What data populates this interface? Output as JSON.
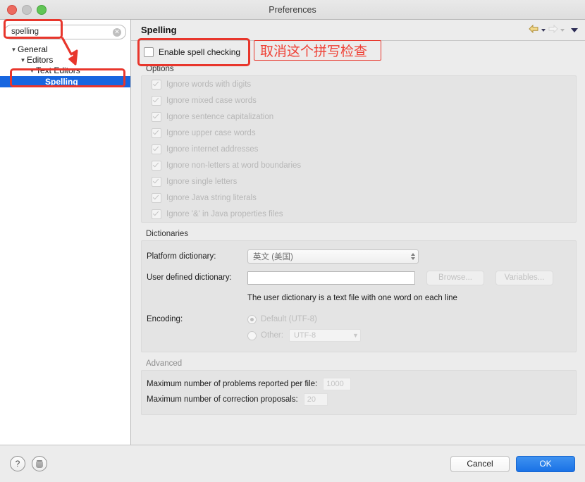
{
  "window": {
    "title": "Preferences",
    "controls": [
      "close-button",
      "minimize-button",
      "zoom-button"
    ]
  },
  "sidebar": {
    "search": {
      "value": "spelling",
      "placeholder": "type filter text",
      "clear_icon": "clear-circle-icon"
    },
    "tree": [
      {
        "label": "General",
        "indent": 0,
        "twisty": "▼",
        "selected": false
      },
      {
        "label": "Editors",
        "indent": 1,
        "twisty": "▼",
        "selected": false
      },
      {
        "label": "Text Editors",
        "indent": 2,
        "twisty": "▼",
        "selected": false
      },
      {
        "label": "Spelling",
        "indent": 3,
        "twisty": "",
        "selected": true
      }
    ]
  },
  "main": {
    "title": "Spelling",
    "nav": {
      "back_icon": "back-arrow-icon",
      "forward_icon": "forward-arrow-icon",
      "menu_icon": "chevron-down-icon"
    },
    "enable": {
      "label": "Enable spell checking",
      "checked": false
    },
    "options": {
      "title": "Options",
      "items": [
        {
          "label": "Ignore words with digits",
          "checked": true
        },
        {
          "label": "Ignore mixed case words",
          "checked": true
        },
        {
          "label": "Ignore sentence capitalization",
          "checked": true
        },
        {
          "label": "Ignore upper case words",
          "checked": true
        },
        {
          "label": "Ignore internet addresses",
          "checked": true
        },
        {
          "label": "Ignore non-letters at word boundaries",
          "checked": true
        },
        {
          "label": "Ignore single letters",
          "checked": true
        },
        {
          "label": "Ignore Java string literals",
          "checked": true
        },
        {
          "label": "Ignore '&' in Java properties files",
          "checked": true
        }
      ]
    },
    "dictionaries": {
      "title": "Dictionaries",
      "platform_label": "Platform dictionary:",
      "platform_value": "英文 (美国)",
      "user_label": "User defined dictionary:",
      "user_value": "",
      "browse_label": "Browse...",
      "variables_label": "Variables...",
      "hint": "The user dictionary is a text file with one word on each line",
      "encoding_label": "Encoding:",
      "encoding_default_label": "Default (UTF-8)",
      "encoding_default_selected": true,
      "encoding_other_label": "Other:",
      "encoding_other_value": "UTF-8"
    },
    "advanced": {
      "title": "Advanced",
      "rows": [
        {
          "label": "Maximum number of problems reported per file:",
          "value": "1000"
        },
        {
          "label": "Maximum number of correction proposals:",
          "value": "20"
        }
      ]
    }
  },
  "footer": {
    "help_icon": "question-mark-icon",
    "restore_icon": "restore-defaults-icon",
    "cancel_label": "Cancel",
    "ok_label": "OK"
  },
  "annotations": {
    "chinese_note": "取消这个拼写检查",
    "highlight_color": "#e8362c",
    "boxes": [
      "search-field-highlight",
      "spelling-node-highlight",
      "enable-checkbox-highlight",
      "chinese-note-box"
    ],
    "arrow": "red-down-arrow"
  },
  "colors": {
    "selection_blue": "#1766e0",
    "annotation_red": "#e8362c",
    "primary_button": "#1a72e6"
  }
}
